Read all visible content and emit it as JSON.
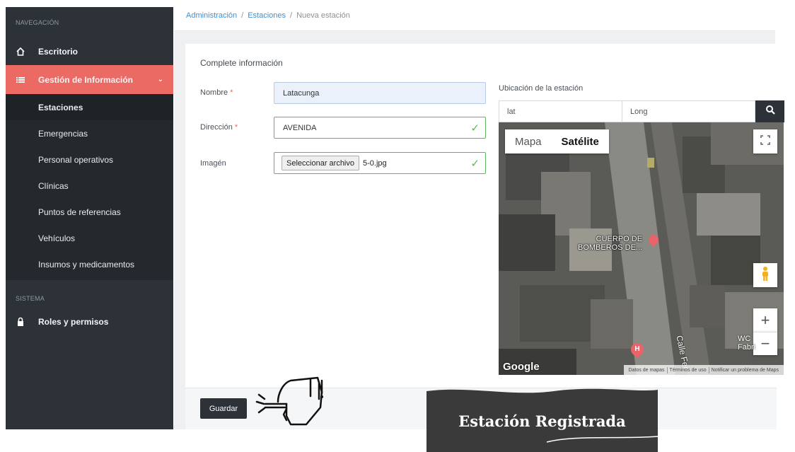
{
  "sidebar": {
    "nav_section": "NAVEGACIÓN",
    "escritorio": "Escritorio",
    "gestion": "Gestión de Información",
    "items": [
      "Estaciones",
      "Emergencias",
      "Personal operativos",
      "Clínicas",
      "Puntos de referencias",
      "Vehículos",
      "Insumos y medicamentos"
    ],
    "system_section": "SISTEMA",
    "roles": "Roles y permisos"
  },
  "breadcrumb": {
    "admin": "Administración",
    "estaciones": "Estaciones",
    "current": "Nueva estación",
    "sep": "/"
  },
  "form": {
    "title": "Complete información",
    "nombre_label": "Nombre",
    "nombre_value": "Latacunga",
    "direccion_label": "Dirección",
    "direccion_value": "AVENIDA",
    "imagen_label": "Imagén",
    "file_button": "Seleccionar archivo",
    "file_name": "5-0.jpg",
    "required_mark": "*",
    "save_label": "Guardar"
  },
  "map": {
    "label": "Ubicación de la estación",
    "lat_placeholder": "lat",
    "long_placeholder": "Long",
    "type_map": "Mapa",
    "type_satellite": "Satélite",
    "poi_line1": "CUERPO DE",
    "poi_line2": "BOMBEROS DE...",
    "street": "Calle Fer",
    "wc_line1": "WC",
    "wc_line2": "Fabri",
    "logo": "Google",
    "footer_data": "Datos de mapas",
    "footer_terms": "Términos de uso",
    "footer_report": "Notificar un problema de Maps"
  },
  "banner": {
    "text": "Estación Registrada"
  },
  "colors": {
    "sidebar_bg": "#2c3238",
    "accent": "#ec6a64",
    "valid_green": "#5cb85c",
    "link_blue": "#3f8fd2"
  }
}
